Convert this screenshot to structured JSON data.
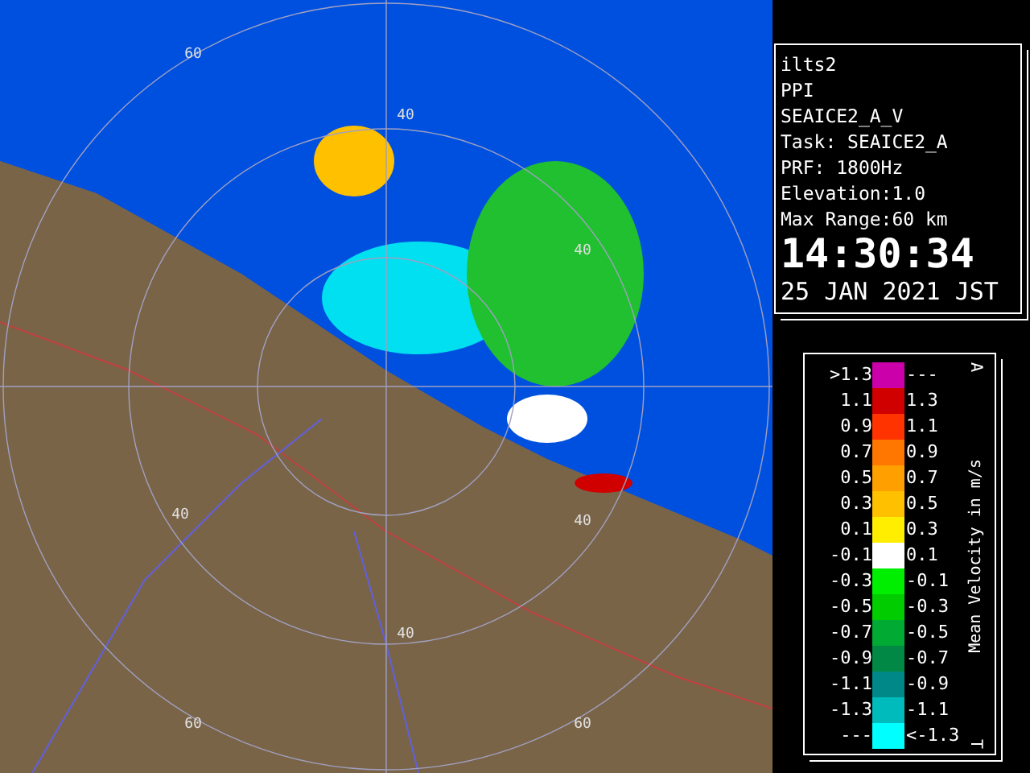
{
  "map": {
    "ring_labels": [
      "60",
      "40",
      "40",
      "40",
      "40",
      "40",
      "60",
      "60"
    ]
  },
  "info": {
    "lines": [
      "ilts2",
      "PPI",
      "SEAICE2_A_V",
      "Task: SEAICE2_A",
      "PRF: 1800Hz",
      "Elevation:1.0",
      "Max Range:60 km"
    ],
    "time": "14:30:34",
    "date": "25 JAN 2021 JST"
  },
  "legend": {
    "title": "Mean Velocity in m/s",
    "top_mark": "A",
    "bottom_mark": "T",
    "rows": [
      {
        "low": ">1.3",
        "high": "---",
        "color": "#cc00aa"
      },
      {
        "low": "1.1",
        "high": "1.3",
        "color": "#d00000"
      },
      {
        "low": "0.9",
        "high": "1.1",
        "color": "#ff3300"
      },
      {
        "low": "0.7",
        "high": "0.9",
        "color": "#ff7700"
      },
      {
        "low": "0.5",
        "high": "0.7",
        "color": "#ffa000"
      },
      {
        "low": "0.3",
        "high": "0.5",
        "color": "#ffc000"
      },
      {
        "low": "0.1",
        "high": "0.3",
        "color": "#ffee00"
      },
      {
        "low": "-0.1",
        "high": "0.1",
        "color": "#ffffff"
      },
      {
        "low": "-0.3",
        "high": "-0.1",
        "color": "#00ee00"
      },
      {
        "low": "-0.5",
        "high": "-0.3",
        "color": "#00cc00"
      },
      {
        "low": "-0.7",
        "high": "-0.5",
        "color": "#00aa33"
      },
      {
        "low": "-0.9",
        "high": "-0.7",
        "color": "#008844"
      },
      {
        "low": "-1.1",
        "high": "-0.9",
        "color": "#008888"
      },
      {
        "low": "-1.3",
        "high": "-1.1",
        "color": "#00bbbb"
      },
      {
        "low": "---",
        "high": "<-1.3",
        "color": "#00ffff"
      }
    ]
  }
}
